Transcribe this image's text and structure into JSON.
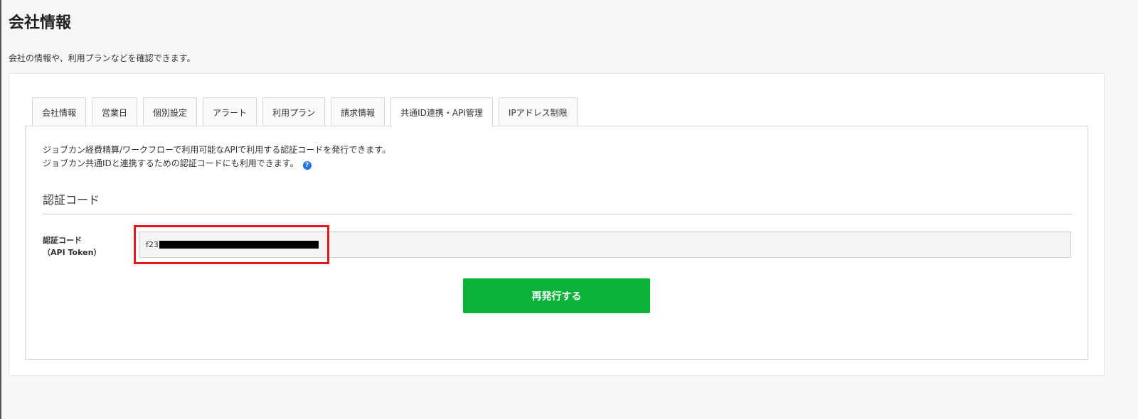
{
  "page": {
    "title": "会社情報",
    "description": "会社の情報や、利用プランなどを確認できます。"
  },
  "tabs": [
    {
      "label": "会社情報",
      "active": false
    },
    {
      "label": "営業日",
      "active": false
    },
    {
      "label": "個別設定",
      "active": false
    },
    {
      "label": "アラート",
      "active": false
    },
    {
      "label": "利用プラン",
      "active": false
    },
    {
      "label": "請求情報",
      "active": false
    },
    {
      "label": "共通ID連携・API管理",
      "active": true
    },
    {
      "label": "IPアドレス制限",
      "active": false
    }
  ],
  "panel": {
    "description_line1": "ジョブカン経費精算/ワークフローで利用可能なAPIで利用する認証コードを発行できます。",
    "description_line2": "ジョブカン共通IDと連携するための認証コードにも利用できます。",
    "section_title": "認証コード",
    "field_label_line1": "認証コード",
    "field_label_line2": "（API Token）",
    "token_prefix": "f23",
    "reissue_label": "再発行する"
  },
  "icons": {
    "help": "question-circle-icon"
  },
  "colors": {
    "primary_button": "#0bb23a",
    "highlight": "#e01b1b",
    "help_icon": "#1a73e8"
  }
}
